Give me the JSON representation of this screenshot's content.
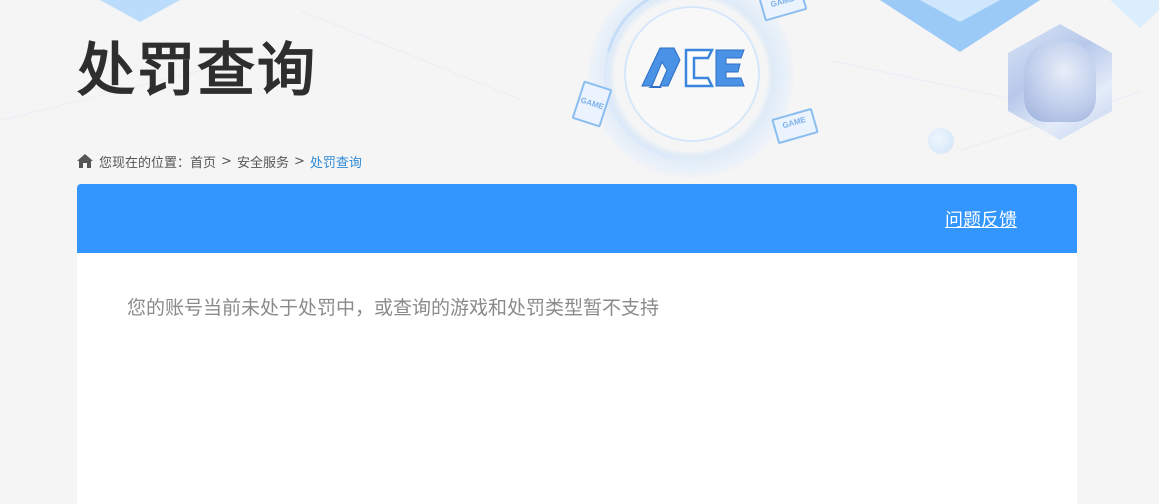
{
  "header": {
    "title": "处罚查询",
    "logo_text": "ACE",
    "game_tags": [
      "GAME",
      "GAME",
      "GAME"
    ]
  },
  "breadcrumb": {
    "prefix": "您现在的位置：",
    "items": [
      "首页",
      "安全服务",
      "处罚查询"
    ],
    "separator": ">"
  },
  "panel": {
    "feedback_label": "问题反馈",
    "message": "您的账号当前未处于处罚中，或查询的游戏和处罚类型暂不支持"
  },
  "colors": {
    "accent": "#3396fe",
    "breadcrumb_current": "#2f8bd8",
    "title": "#2e2e2e",
    "message": "#8a8a8a",
    "background": "#f5f5f5"
  },
  "icons": [
    "home-icon",
    "ace-logo-icon"
  ]
}
